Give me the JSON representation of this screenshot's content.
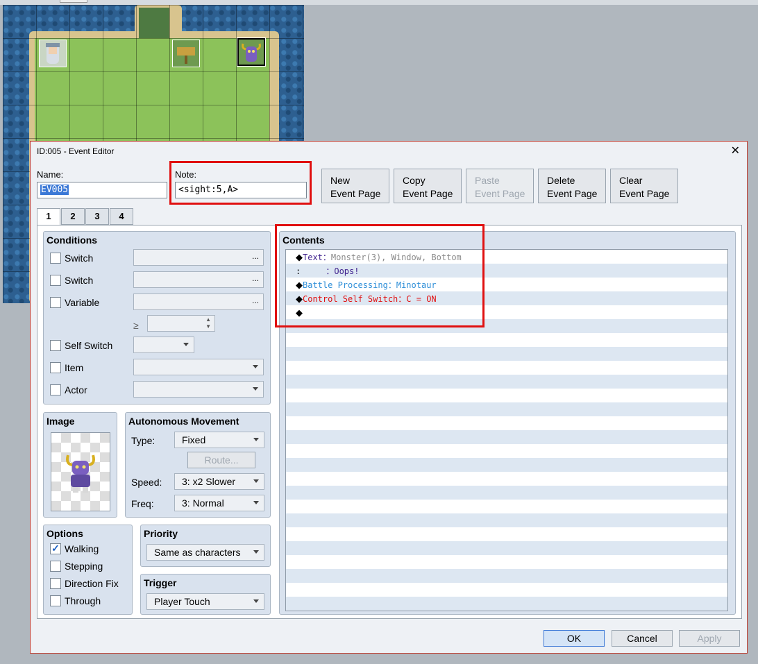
{
  "window": {
    "title": "ID:005 - Event Editor",
    "close": "✕"
  },
  "name": {
    "label": "Name:",
    "value": "EV005"
  },
  "note": {
    "label": "Note:",
    "value": "<sight:5,A>"
  },
  "page_buttons": [
    {
      "line1": "New",
      "line2": "Event Page",
      "enabled": true
    },
    {
      "line1": "Copy",
      "line2": "Event Page",
      "enabled": true
    },
    {
      "line1": "Paste",
      "line2": "Event Page",
      "enabled": false
    },
    {
      "line1": "Delete",
      "line2": "Event Page",
      "enabled": true
    },
    {
      "line1": "Clear",
      "line2": "Event Page",
      "enabled": true
    }
  ],
  "tabs": [
    "1",
    "2",
    "3",
    "4"
  ],
  "conditions": {
    "title": "Conditions",
    "switch1": "Switch",
    "switch2": "Switch",
    "variable": "Variable",
    "ge": "≥",
    "self_switch": "Self Switch",
    "item": "Item",
    "actor": "Actor",
    "dots": "..."
  },
  "image": {
    "title": "Image"
  },
  "movement": {
    "title": "Autonomous Movement",
    "type_label": "Type:",
    "type_value": "Fixed",
    "route_button": "Route...",
    "speed_label": "Speed:",
    "speed_value": "3: x2 Slower",
    "freq_label": "Freq:",
    "freq_value": "3: Normal"
  },
  "options": {
    "title": "Options",
    "walking": "Walking",
    "stepping": "Stepping",
    "direction_fix": "Direction Fix",
    "through": "Through",
    "walking_checked": "✓"
  },
  "priority": {
    "title": "Priority",
    "value": "Same as characters"
  },
  "trigger": {
    "title": "Trigger",
    "value": "Player Touch"
  },
  "contents": {
    "title": "Contents",
    "lines": [
      {
        "marker": "◆",
        "cmd": "Text",
        "sep": "：",
        "args": "Monster(3), Window, Bottom",
        "cmd_color": "#3d1f8c",
        "args_color": "#8a8a8a"
      },
      {
        "marker": ":",
        "cmd": "",
        "sep": "     ：",
        "args": "Oops!",
        "cmd_color": "#3d1f8c",
        "args_color": "#3d1f8c"
      },
      {
        "marker": "◆",
        "cmd": "Battle Processing",
        "sep": "：",
        "args": "Minotaur",
        "cmd_color": "#2f8fd8",
        "args_color": "#2f8fd8"
      },
      {
        "marker": "◆",
        "cmd": "Control Self Switch",
        "sep": "：",
        "args": "C = ON",
        "cmd_color": "#e01010",
        "args_color": "#e01010"
      },
      {
        "marker": "◆",
        "cmd": "",
        "sep": "",
        "args": "",
        "cmd_color": "#000",
        "args_color": "#000"
      }
    ]
  },
  "footer": {
    "ok": "OK",
    "cancel": "Cancel",
    "apply": "Apply"
  }
}
